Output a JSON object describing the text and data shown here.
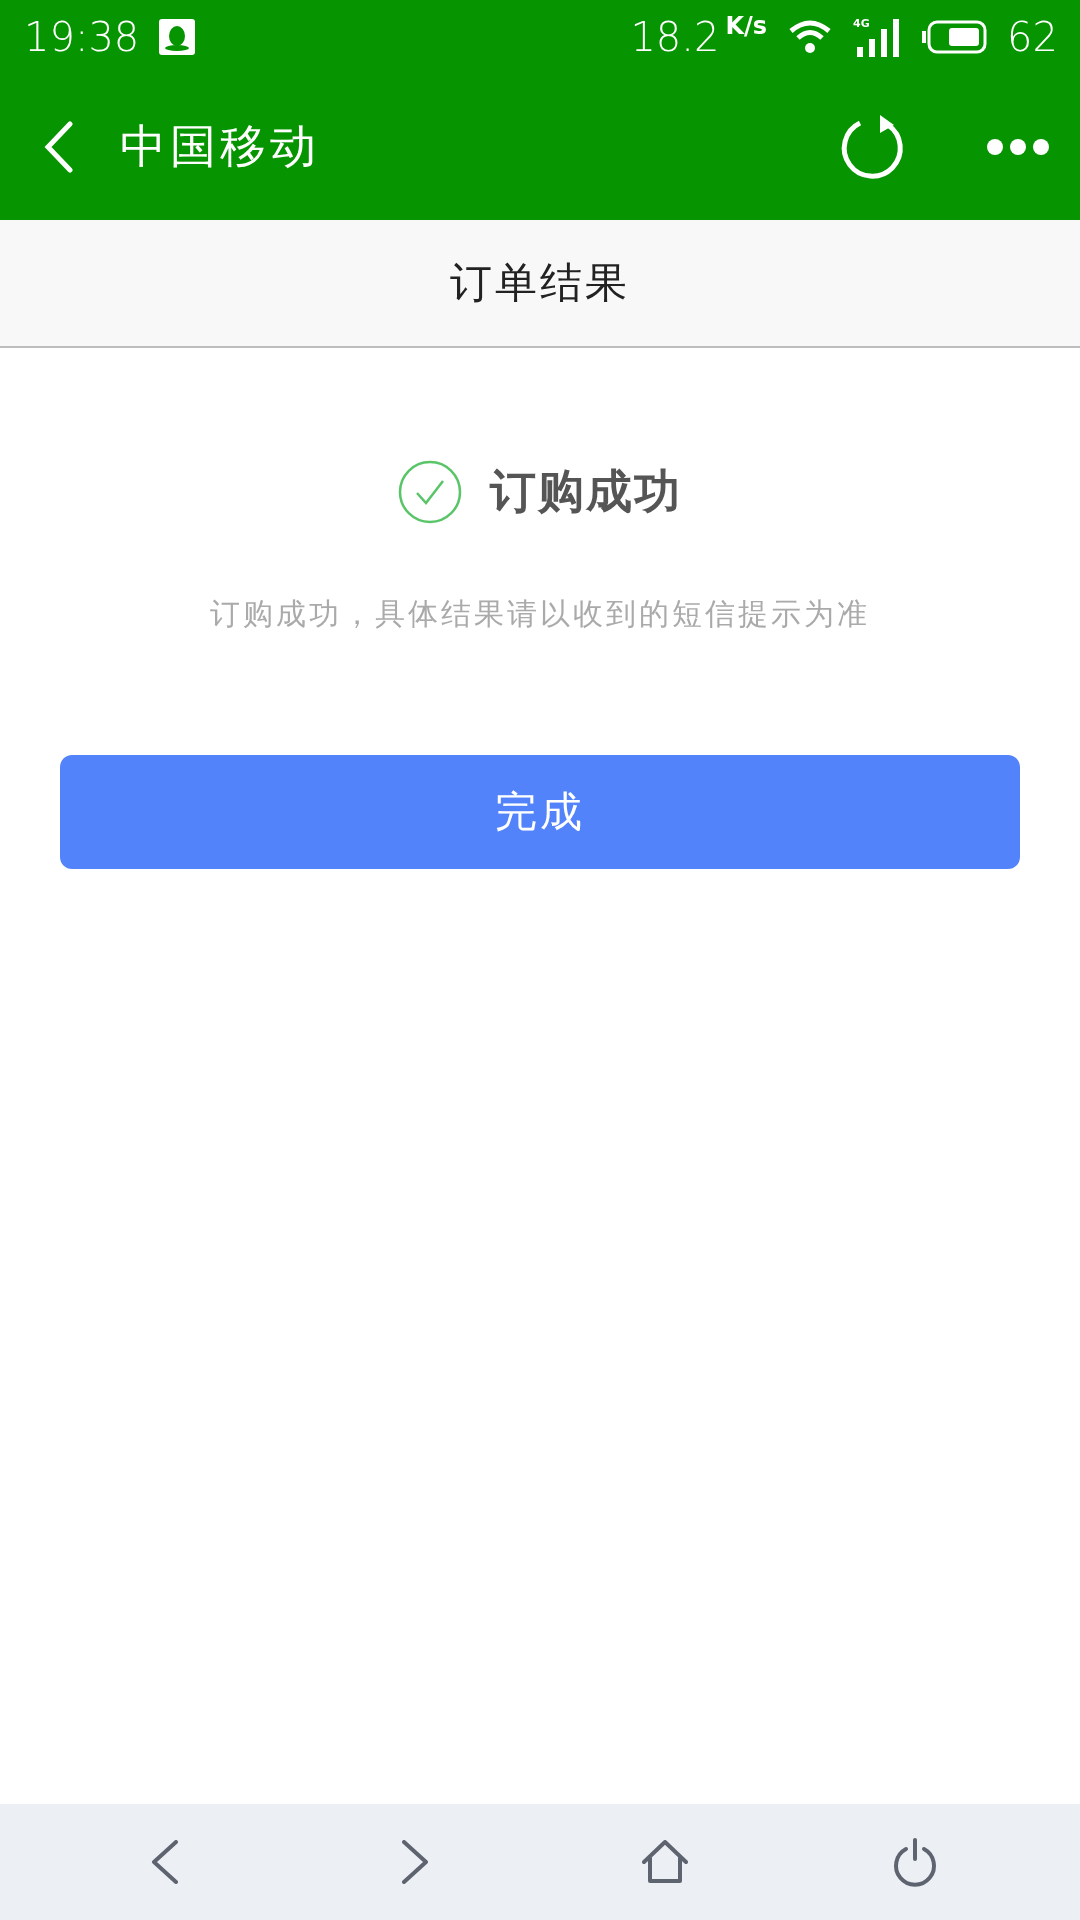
{
  "status_bar": {
    "time": "19:38",
    "network_speed": "18.2",
    "speed_unit": "K/s",
    "network_type": "4G",
    "battery": "62"
  },
  "app_bar": {
    "title": "中国移动"
  },
  "page_header": {
    "title": "订单结果"
  },
  "result": {
    "title": "订购成功",
    "message": "订购成功，具体结果请以收到的短信提示为准"
  },
  "done_button": {
    "label": "完成"
  }
}
